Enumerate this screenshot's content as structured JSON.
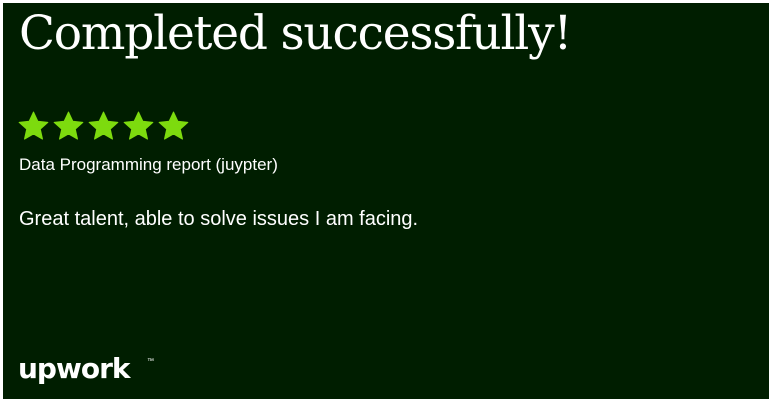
{
  "card": {
    "title": "Completed successfully!",
    "rating": {
      "value": 5,
      "max": 5,
      "star_color": "#7ddb0e",
      "icon": "star-icon"
    },
    "project_title": "Data Programming report (juypter)",
    "feedback": "Great talent, able to solve issues I am facing.",
    "brand": {
      "logo_text": "upwork",
      "trademark": "™"
    },
    "colors": {
      "background": "#001e00",
      "text": "#ffffff",
      "accent": "#7ddb0e"
    }
  }
}
